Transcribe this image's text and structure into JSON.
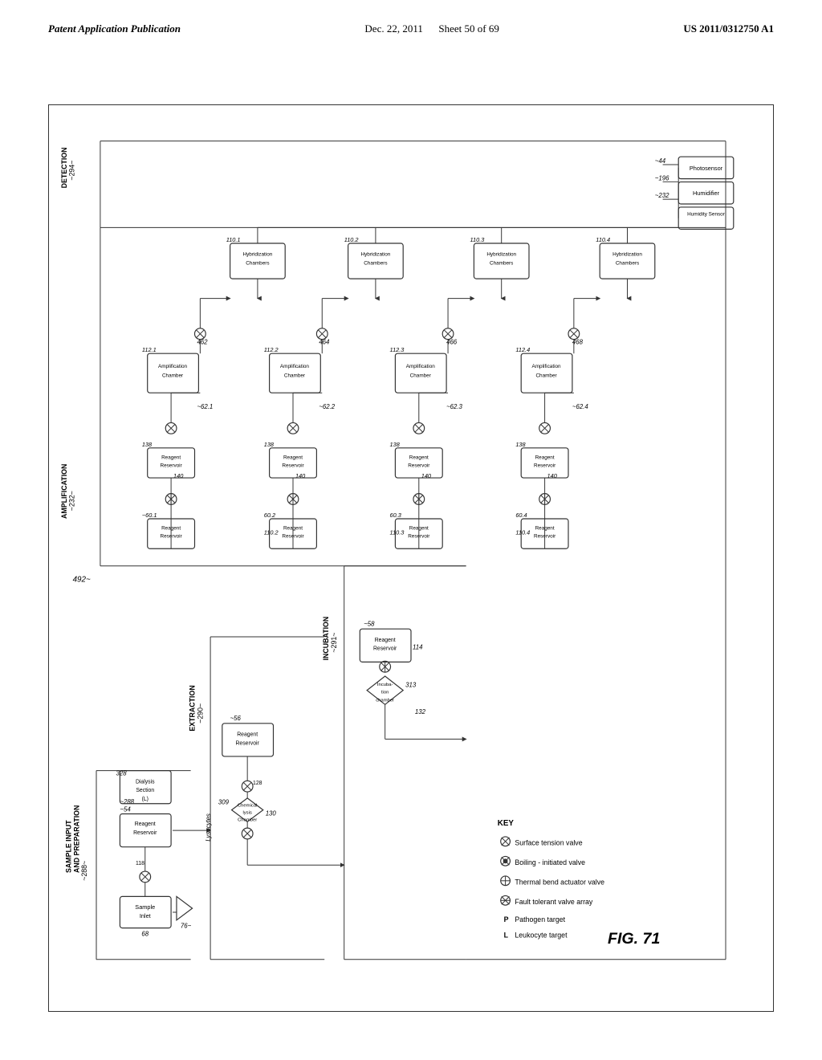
{
  "header": {
    "left": "Patent Application Publication",
    "center_date": "Dec. 22, 2011",
    "center_sheet": "Sheet 50 of 69",
    "right": "US 2011/0312750 A1"
  },
  "figure": {
    "label": "FIG. 71",
    "caption": "Patent diagram showing microfluidic system with sample input, extraction, incubation, amplification, and detection stages"
  }
}
